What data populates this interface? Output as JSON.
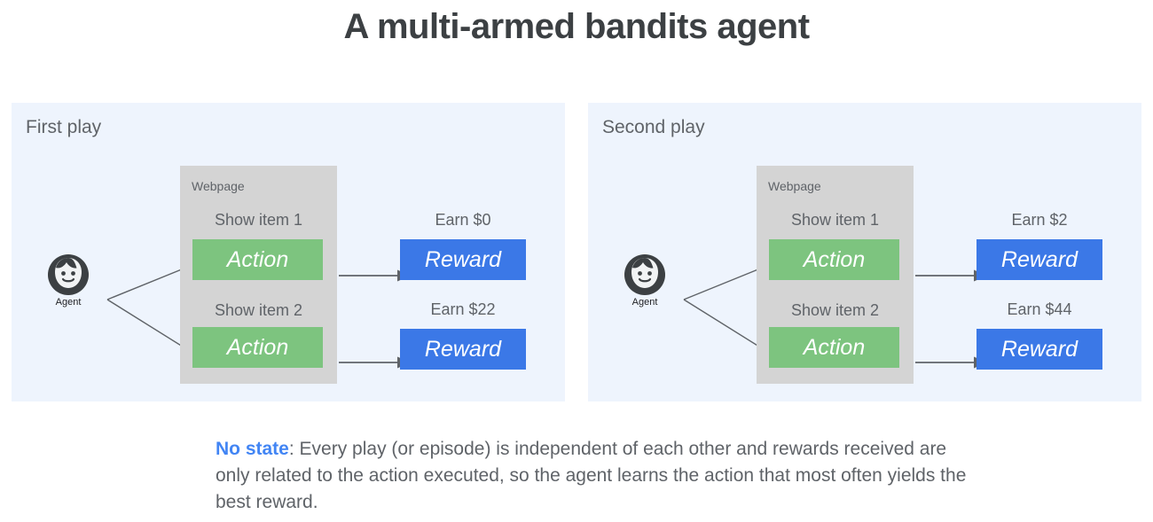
{
  "title": "A multi-armed bandits agent",
  "colors": {
    "panel_bg": "#eef4fd",
    "webpage_bg": "#d4d4d4",
    "action_green": "#7dc47f",
    "reward_blue": "#3b78e7",
    "accent_blue": "#4285f4",
    "text_gray": "#5f6368",
    "title_gray": "#3c4043"
  },
  "panels": [
    {
      "title": "First play",
      "agent_label": "Agent",
      "webpage_label": "Webpage",
      "rows": [
        {
          "item_label": "Show item 1",
          "action_label": "Action",
          "earn_label": "Earn $0",
          "reward_label": "Reward",
          "reward_value": 0
        },
        {
          "item_label": "Show item 2",
          "action_label": "Action",
          "earn_label": "Earn $22",
          "reward_label": "Reward",
          "reward_value": 22
        }
      ]
    },
    {
      "title": "Second play",
      "agent_label": "Agent",
      "webpage_label": "Webpage",
      "rows": [
        {
          "item_label": "Show item 1",
          "action_label": "Action",
          "earn_label": "Earn $2",
          "reward_label": "Reward",
          "reward_value": 2
        },
        {
          "item_label": "Show item 2",
          "action_label": "Action",
          "earn_label": "Earn $44",
          "reward_label": "Reward",
          "reward_value": 44
        }
      ]
    }
  ],
  "caption": {
    "lead": "No state",
    "body": ": Every play (or episode) is independent of each other and rewards received are only related to the action executed, so the agent learns the action that most often yields the best reward."
  }
}
